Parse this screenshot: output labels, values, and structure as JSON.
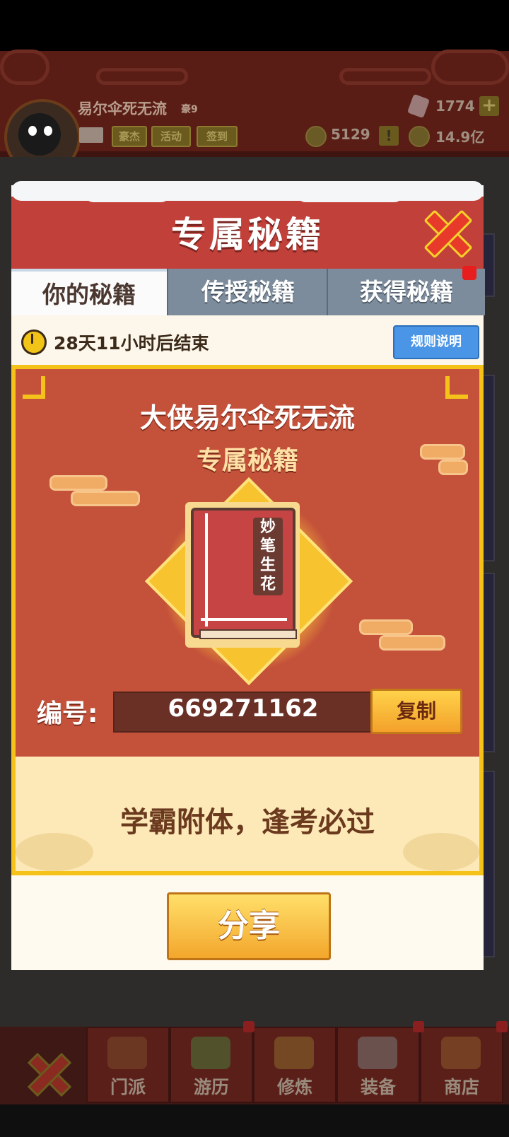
{
  "player": {
    "name": "易尔伞死无流",
    "rank": "豪9",
    "buttons": [
      "豪杰",
      "活动",
      "签到"
    ],
    "gems": "1774",
    "silver": "5129",
    "gold": "14.9亿"
  },
  "dialog": {
    "title": "专属秘籍",
    "tabs": [
      "你的秘籍",
      "传授秘籍",
      "获得秘籍"
    ],
    "timer": "28天11小时后结束",
    "rules_button": "规则说明",
    "card_title_line1": "大侠易尔伞死无流",
    "card_title_line2": "专属秘籍",
    "book_title": "妙笔生花",
    "id_label": "编号:",
    "id_value": "669271162",
    "copy_button": "复制",
    "slogan": "学霸附体，逢考必过",
    "share_button": "分享"
  },
  "nav": {
    "items": [
      "门派",
      "游历",
      "修炼",
      "装备",
      "商店"
    ]
  },
  "colors": {
    "header_red": "#c2403a",
    "gold_border": "#f5c21a",
    "tab_inactive": "#7d8c9c",
    "rules_blue": "#4a95e6"
  }
}
